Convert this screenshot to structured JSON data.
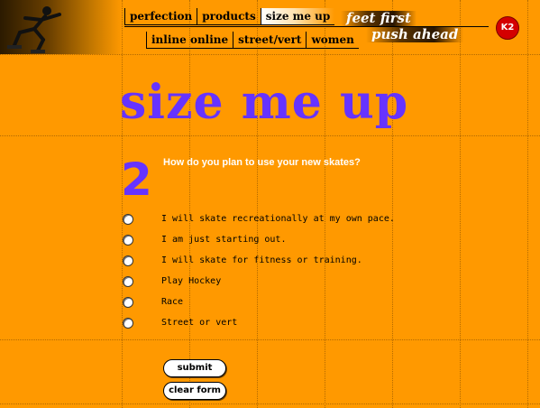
{
  "nav": {
    "primary": [
      "perfection",
      "products",
      "size me up"
    ],
    "secondary": [
      "inline online",
      "street/vert",
      "women"
    ]
  },
  "tagline": {
    "line1": "feet first",
    "line2": "push ahead"
  },
  "logo": {
    "text": "K2"
  },
  "page": {
    "title": "size me up"
  },
  "question": {
    "number": "2",
    "text": "How do you plan to use your new skates?",
    "options": [
      "I will skate recreationally at my own pace.",
      "I am just starting out.",
      "I will skate for fitness or training.",
      "Play Hockey",
      "Race",
      "Street or vert"
    ]
  },
  "buttons": {
    "submit": "submit",
    "clear": "clear form"
  },
  "colors": {
    "background": "#ff9900",
    "accent": "#6633ff",
    "logo": "#d40000"
  }
}
